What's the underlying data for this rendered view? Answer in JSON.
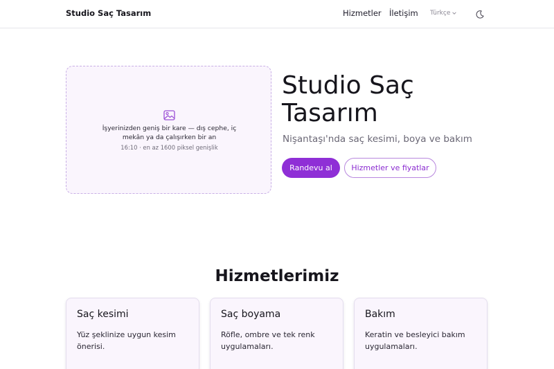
{
  "header": {
    "brand": "Studio Saç Tasarım",
    "nav": [
      "Hizmetler",
      "İletişim"
    ],
    "language": "Türkçe",
    "theme_icon": "moon-icon"
  },
  "hero": {
    "placeholder": {
      "icon": "image-icon",
      "text": "İşyerinizden geniş bir kare — dış cephe, iç mekân ya da çalışırken bir an",
      "spec": "16:10 · en az 1600 piksel genişlik"
    },
    "title": "Studio Saç Tasarım",
    "subtitle": "Nişantaşı'nda saç kesimi, boya ve bakım",
    "primary_cta": "Randevu al",
    "secondary_cta": "Hizmetler ve fiyatlar"
  },
  "services": {
    "title": "Hizmetlerimiz",
    "cards": [
      {
        "title": "Saç kesimi",
        "text": "Yüz şeklinize uygun kesim önerisi."
      },
      {
        "title": "Saç boyama",
        "text": "Röfle, ombre ve tek renk uygulamaları."
      },
      {
        "title": "Bakım",
        "text": "Keratin ve besleyici bakım uygulamaları."
      }
    ]
  },
  "colors": {
    "accent": "#8f2fd6",
    "accent_border": "#b887de",
    "card_bg": "#faf5fd"
  }
}
